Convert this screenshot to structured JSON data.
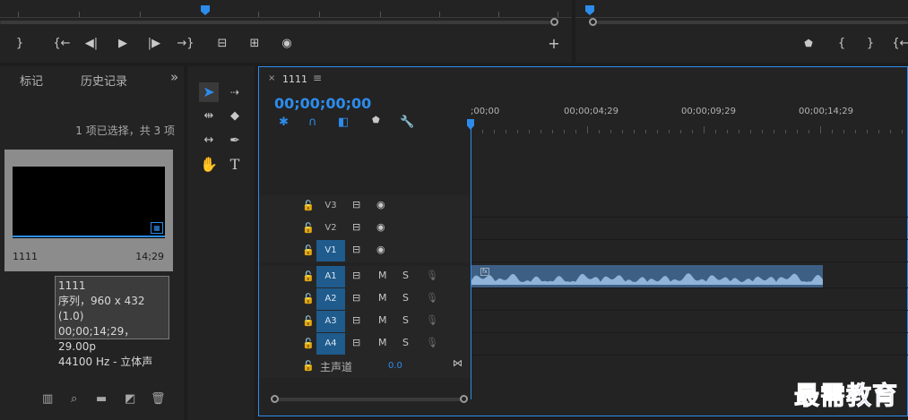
{
  "source_monitor": {
    "controls": [
      "}",
      "{←",
      "◀|",
      "▶",
      "|▶",
      "→}",
      "⊟",
      "⊞",
      "◉"
    ],
    "add_label": "+"
  },
  "program_monitor": {
    "controls": [
      "⬟",
      "{",
      "}",
      "{←"
    ]
  },
  "left_panel": {
    "tabs": [
      "标记",
      "历史记录"
    ],
    "overflow": "»",
    "selection_info": "1 项已选择，共 3 项",
    "item": {
      "name": "1111",
      "duration": "14;29"
    },
    "tooltip": {
      "line1": "1111",
      "line2": "序列，960 x 432 (1.0)",
      "line3": "00;00;14;29，29.00p",
      "line4": "44100 Hz - 立体声"
    }
  },
  "timeline": {
    "sequence_name": "1111",
    "close": "×",
    "menu": "≡",
    "timecode": "00;00;00;00",
    "ruler_labels": [
      ";00;00",
      "00;00;04;29",
      "00;00;09;29",
      "00;00;14;29"
    ],
    "tracks": [
      {
        "name": "V3",
        "type": "video",
        "selected": false
      },
      {
        "name": "V2",
        "type": "video",
        "selected": false
      },
      {
        "name": "V1",
        "type": "video",
        "selected": true
      },
      {
        "name": "A1",
        "type": "audio",
        "selected": true
      },
      {
        "name": "A2",
        "type": "audio",
        "selected": true
      },
      {
        "name": "A3",
        "type": "audio",
        "selected": true
      },
      {
        "name": "A4",
        "type": "audio",
        "selected": true
      }
    ],
    "mute_label": "M",
    "solo_label": "S",
    "master": {
      "label": "主声道",
      "value": "0.0"
    }
  },
  "watermark": "最需教育",
  "colors": {
    "accent": "#2d8ceb",
    "selected_track": "#1f5b8c",
    "clip": "#3e5f84",
    "waveform": "#8fb3d9"
  }
}
